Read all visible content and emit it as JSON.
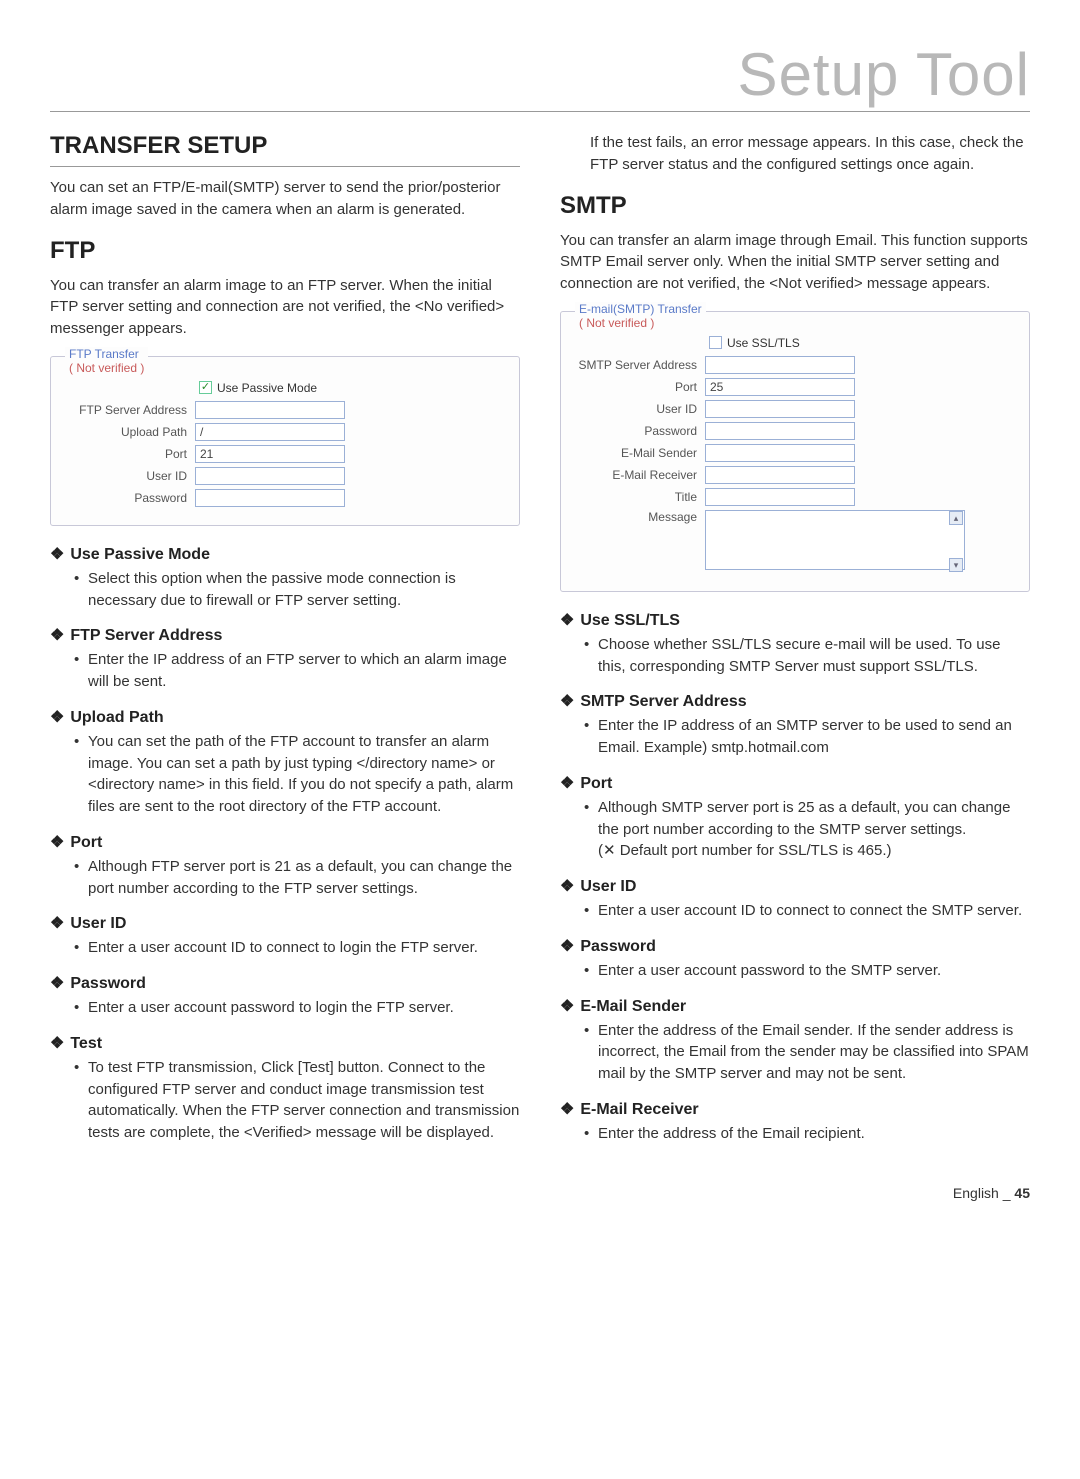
{
  "page_header": "Setup Tool",
  "footer_lang": "English",
  "footer_dash": "_",
  "footer_page": "45",
  "left": {
    "transfer_heading": "TRANSFER SETUP",
    "transfer_desc": "You can set an FTP/E-mail(SMTP) server to send the prior/posterior alarm image saved in the camera when an alarm is generated.",
    "ftp_heading": "FTP",
    "ftp_desc": "You can transfer an alarm image to an FTP server. When the initial FTP server setting and connection are not verified, the <No verified> messenger appears.",
    "ftp_panel": {
      "legend_title": "FTP Transfer",
      "legend_status": "( Not verified )",
      "use_passive_mode": "Use Passive Mode",
      "fields": {
        "server_addr_label": "FTP Server Address",
        "server_addr_value": "",
        "upload_path_label": "Upload Path",
        "upload_path_value": "/",
        "port_label": "Port",
        "port_value": "21",
        "user_id_label": "User ID",
        "user_id_value": "",
        "password_label": "Password",
        "password_value": ""
      }
    },
    "items": {
      "use_passive": {
        "title": "Use Passive Mode",
        "bullet": "Select this option when the passive mode connection is necessary due to firewall or FTP server setting."
      },
      "server_addr": {
        "title": "FTP Server Address",
        "bullet": "Enter the IP address of an FTP server to which an alarm image will be sent."
      },
      "upload_path": {
        "title": "Upload Path",
        "bullet": "You can set the path of the FTP account to transfer an alarm image. You can set a path by just typing </directory name> or <directory name> in this field. If you do not specify a path, alarm files are sent to the root directory of the FTP account."
      },
      "port": {
        "title": "Port",
        "bullet": "Although FTP server port is 21 as a default, you can change the port number according to the FTP server settings."
      },
      "user_id": {
        "title": "User ID",
        "bullet": "Enter a user account ID to connect to login the FTP server."
      },
      "password": {
        "title": "Password",
        "bullet": "Enter a user account password to login the FTP server."
      },
      "test": {
        "title": "Test",
        "bullet": "To test FTP transmission, Click [Test] button. Connect to the configured FTP server and conduct image transmission test automatically. When the FTP server connection and transmission tests are complete, the <Verified> message will be displayed."
      }
    }
  },
  "right": {
    "test_fail_text": "If the test fails, an error message appears. In this case, check the FTP server status and the configured settings once again.",
    "smtp_heading": "SMTP",
    "smtp_desc": "You can transfer an alarm image through Email. This function supports SMTP Email server only. When the initial SMTP server setting and connection are not verified, the <Not verified> message appears.",
    "smtp_panel": {
      "legend_title": "E-mail(SMTP) Transfer",
      "legend_status": "( Not verified )",
      "use_ssl": "Use SSL/TLS",
      "fields": {
        "server_addr_label": "SMTP Server Address",
        "server_addr_value": "",
        "port_label": "Port",
        "port_value": "25",
        "user_id_label": "User ID",
        "user_id_value": "",
        "password_label": "Password",
        "password_value": "",
        "sender_label": "E-Mail Sender",
        "sender_value": "",
        "receiver_label": "E-Mail Receiver",
        "receiver_value": "",
        "title_label": "Title",
        "title_value": "",
        "message_label": "Message",
        "message_value": ""
      }
    },
    "items": {
      "use_ssl": {
        "title": "Use SSL/TLS",
        "bullet": "Choose whether SSL/TLS secure e-mail will be used. To use this, corresponding SMTP Server must support SSL/TLS."
      },
      "server_addr": {
        "title": "SMTP Server Address",
        "bullet": "Enter the IP address of an SMTP server to be used to send an Email. Example) smtp.hotmail.com"
      },
      "port": {
        "title": "Port",
        "bullet": "Although SMTP server port is 25 as a default, you can change the port number according to the SMTP server settings.",
        "note": "(✕ Default port number for SSL/TLS is 465.)"
      },
      "user_id": {
        "title": "User ID",
        "bullet": "Enter a user account ID to connect to connect the SMTP server."
      },
      "password": {
        "title": "Password",
        "bullet": "Enter a user account password to the SMTP server."
      },
      "sender": {
        "title": "E-Mail Sender",
        "bullet": "Enter the address of the Email sender. If the sender address is incorrect, the Email from the sender may be classified into SPAM mail by the SMTP server and may not be sent."
      },
      "receiver": {
        "title": "E-Mail Receiver",
        "bullet": "Enter the address of the Email recipient."
      }
    }
  }
}
